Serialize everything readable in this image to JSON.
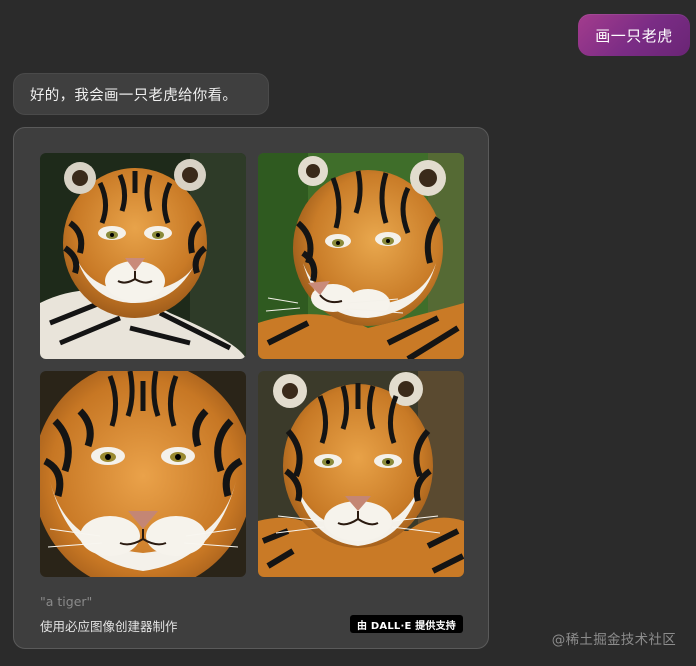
{
  "user_message": {
    "text": "画一只老虎",
    "bubble_color": "#8e3288"
  },
  "bot_message": {
    "text": "好的，我会画一只老虎给你看。"
  },
  "image_result": {
    "prompt": "\"a tiger\"",
    "creator_label": "使用必应图像创建器制作",
    "badge_label": "由 DALL·E 提供支持",
    "images": [
      {
        "subject": "tiger",
        "background": "#1e2a1a"
      },
      {
        "subject": "tiger",
        "background": "#3f6e2a"
      },
      {
        "subject": "tiger",
        "background": "#2a2418"
      },
      {
        "subject": "tiger",
        "background": "#3b3a2a"
      }
    ]
  },
  "watermark": "@稀土掘金技术社区",
  "colors": {
    "page_background": "#2b2b2b",
    "card_background": "#3e3e3e",
    "tiger_orange": "#d0812c",
    "tiger_stripe": "#141414"
  }
}
